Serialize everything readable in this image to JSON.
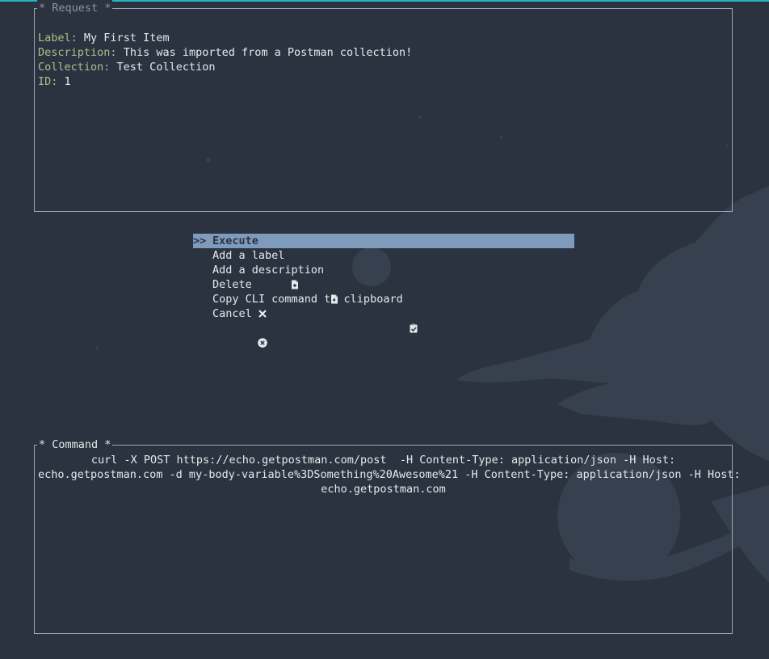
{
  "request": {
    "title": "Request",
    "rows": [
      {
        "key": "Label:",
        "value": "My First Item"
      },
      {
        "key": "Description:",
        "value": "This was imported from a Postman collection!"
      },
      {
        "key": "Collection:",
        "value": "Test Collection"
      },
      {
        "key": "ID:",
        "value": "1"
      }
    ]
  },
  "menu": {
    "pointer": ">>",
    "items": [
      {
        "label": "Execute",
        "icon": "lightning-icon"
      },
      {
        "label": "Add a label",
        "icon": "file-plus-icon"
      },
      {
        "label": "Add a description",
        "icon": "file-plus-icon"
      },
      {
        "label": "Delete",
        "icon": "x-icon"
      },
      {
        "label": "Copy CLI command to clipboard",
        "icon": "clipboard-check-icon"
      },
      {
        "label": "Cancel",
        "icon": "x-circle-icon"
      }
    ],
    "selected_index": 0
  },
  "command": {
    "title": "Command",
    "lines": [
      "curl -X POST https://echo.getpostman.com/post  -H Content-Type: application/json -H Host:",
      "echo.getpostman.com -d my-body-variable%3DSomething%20Awesome%21 -H Content-Type: application/json -H Host:",
      "echo.getpostman.com"
    ]
  },
  "colors": {
    "background": "#2c3340",
    "border": "#9aa6b6",
    "key_text": "#a9c08a",
    "selection": "#7f9bbb",
    "accent": "#27b4c4"
  }
}
